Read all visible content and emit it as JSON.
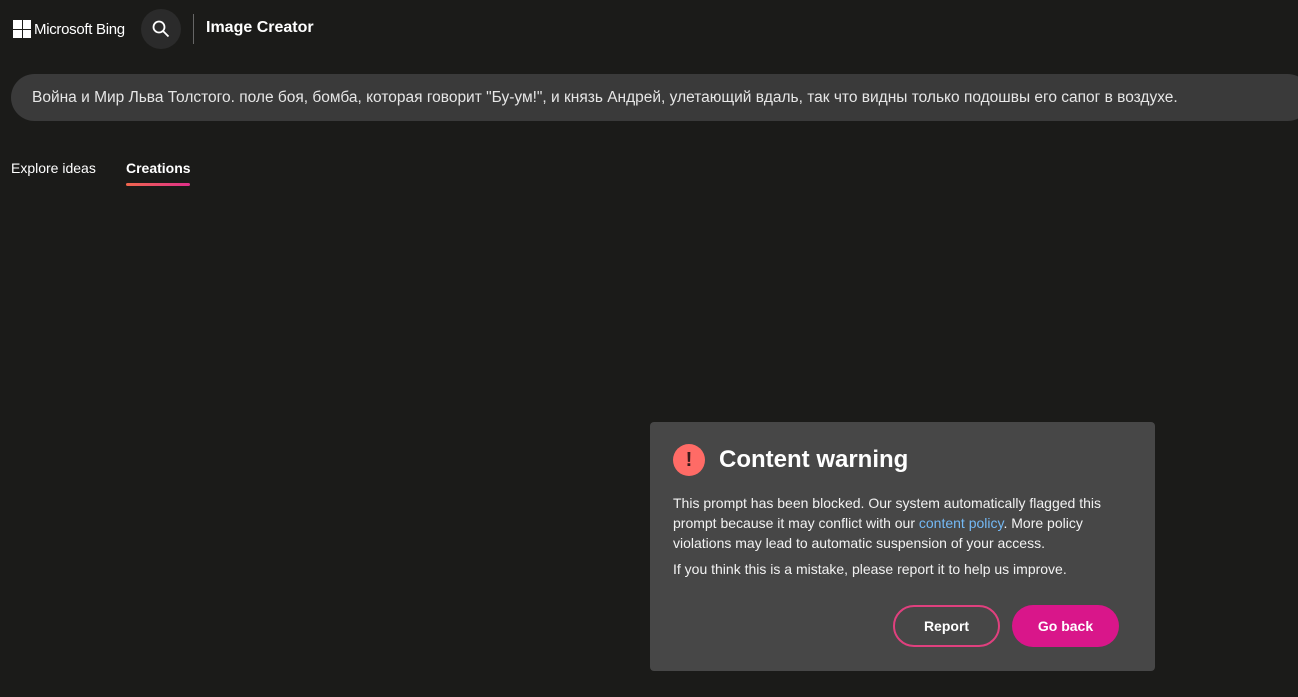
{
  "header": {
    "brand": "Microsoft Bing",
    "title": "Image Creator",
    "search_icon": "search-icon"
  },
  "prompt": {
    "value": "Война и Мир Льва Толстого. поле боя, бомба, которая говорит \"Бу-ум!\", и князь Андрей, улетающий вдаль, так что видны только подошвы его сапог в воздухе."
  },
  "tabs": [
    {
      "label": "Explore ideas"
    },
    {
      "label": "Creations",
      "active": true
    }
  ],
  "dialog": {
    "title": "Content warning",
    "text_before": "This prompt has been blocked. Our system automatically flagged this prompt because it may conflict with our ",
    "link": "content policy",
    "text_after": ". More policy violations may lead to automatic suspension of your access.",
    "text2": "If you think this is a mistake, please report it to help us improve.",
    "report": "Report",
    "go_back": "Go back"
  },
  "colors": {
    "accent": "#d9168a",
    "warning": "#ff6b66",
    "link": "#74b9f5"
  }
}
